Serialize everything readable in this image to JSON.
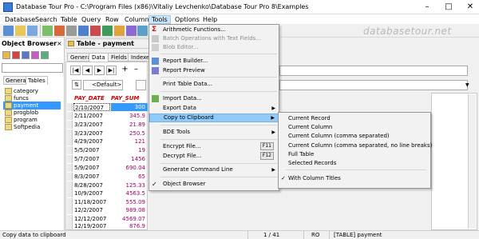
{
  "window": {
    "title": "Database Tour Pro - C:\\Program Files (x86)\\Vitaliy Levchenko\\Database Tour Pro 8\\Examples"
  },
  "menubar": [
    {
      "label": "Database"
    },
    {
      "label": "Search"
    },
    {
      "label": "Table"
    },
    {
      "label": "Query"
    },
    {
      "label": "Row"
    },
    {
      "label": "Column"
    },
    {
      "label": "Tools"
    },
    {
      "label": "Options"
    },
    {
      "label": "Help"
    }
  ],
  "watermark": "databasetour.net",
  "object_browser": {
    "title": "Object Browser",
    "tabs": [
      {
        "label": "General"
      },
      {
        "label": "Tables"
      }
    ],
    "items": [
      {
        "label": "category"
      },
      {
        "label": "funcs"
      },
      {
        "label": "payment"
      },
      {
        "label": "progblob"
      },
      {
        "label": "program"
      },
      {
        "label": "Softpedia"
      }
    ]
  },
  "child": {
    "title": "Table - payment",
    "tabs": [
      {
        "label": "General"
      },
      {
        "label": "Data"
      },
      {
        "label": "Fields"
      },
      {
        "label": "Indexes"
      }
    ],
    "default_label": "<Default>",
    "columns": {
      "date": "PAY_DATE",
      "sum": "PAY_SUM"
    },
    "rows": [
      {
        "date": "2/10/2007",
        "sum": "300"
      },
      {
        "date": "2/11/2007",
        "sum": "345.9"
      },
      {
        "date": "3/23/2007",
        "sum": "21.89"
      },
      {
        "date": "3/23/2007",
        "sum": "250.5"
      },
      {
        "date": "4/29/2007",
        "sum": "121"
      },
      {
        "date": "5/5/2007",
        "sum": "19"
      },
      {
        "date": "5/7/2007",
        "sum": "1456"
      },
      {
        "date": "5/9/2007",
        "sum": "690.04"
      },
      {
        "date": "8/3/2007",
        "sum": "65"
      },
      {
        "date": "8/28/2007",
        "sum": "125.33"
      },
      {
        "date": "10/9/2007",
        "sum": "4563.5"
      },
      {
        "date": "11/18/2007",
        "sum": "555.09"
      },
      {
        "date": "12/2/2007",
        "sum": "989.08"
      },
      {
        "date": "12/12/2007",
        "sum": "4569.07"
      },
      {
        "date": "12/19/2007",
        "sum": "876.9"
      }
    ]
  },
  "tools_menu": {
    "items": [
      {
        "label": "Arithmetic Functions..."
      },
      {
        "label": "Batch Operations with Text Fields..."
      },
      {
        "label": "Blob Editor..."
      },
      {
        "label": "Report Builder..."
      },
      {
        "label": "Report Preview"
      },
      {
        "label": "Print Table Data..."
      },
      {
        "label": "Import Data..."
      },
      {
        "label": "Export Data"
      },
      {
        "label": "Copy to Clipboard"
      },
      {
        "label": "BDE Tools"
      },
      {
        "label": "Encrypt File...",
        "shortcut": "F11"
      },
      {
        "label": "Decrypt File...",
        "shortcut": "F12"
      },
      {
        "label": "Generate Command Line"
      },
      {
        "label": "Object Browser",
        "check": "✓"
      }
    ]
  },
  "clipboard_submenu": {
    "items": [
      {
        "label": "Current Record"
      },
      {
        "label": "Current Column"
      },
      {
        "label": "Current Column (comma separated)"
      },
      {
        "label": "Current Column (comma separated, no line breaks)"
      },
      {
        "label": "Full Table"
      },
      {
        "label": "Selected Records"
      },
      {
        "label": "With Column Titles",
        "check": "✓"
      }
    ]
  },
  "statusbar": {
    "hint": "Copy data to clipboard",
    "position": "1 / 41",
    "mode": "RO",
    "object": "[TABLE] payment"
  },
  "colors": {
    "accent": "#3399ff",
    "menu_highlight": "#91c9f7",
    "header_red": "#d40000"
  }
}
